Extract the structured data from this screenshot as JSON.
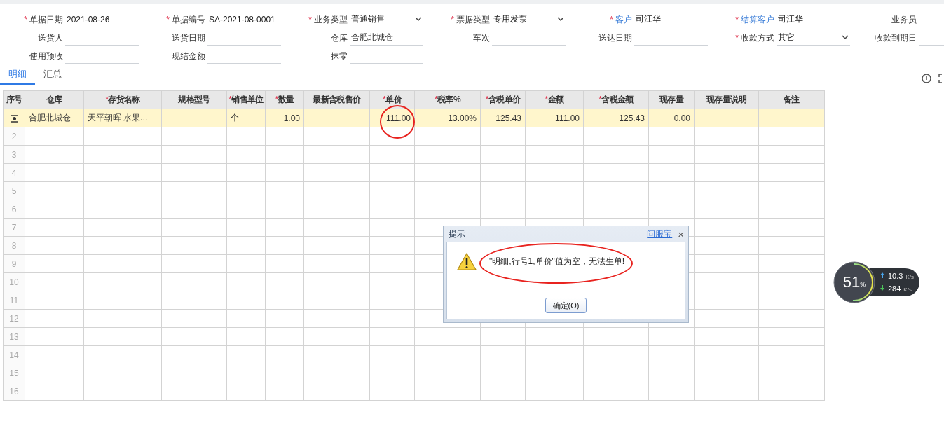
{
  "form": {
    "rows": [
      [
        {
          "mark": "*",
          "label": "单据日期",
          "value": "2021-08-26",
          "kind": "text",
          "link": false
        },
        {
          "mark": "*",
          "label": "单据编号",
          "value": "SA-2021-08-0001",
          "kind": "text",
          "link": false
        },
        {
          "mark": "*",
          "label": "业务类型",
          "value": "普通销售",
          "kind": "select",
          "link": false
        },
        {
          "mark": "*",
          "label": "票据类型",
          "value": "专用发票",
          "kind": "select",
          "link": false
        },
        {
          "mark": "*",
          "label": "客户",
          "value": "司江华",
          "kind": "text",
          "link": true
        },
        {
          "mark": "*",
          "label": "结算客户",
          "value": "司江华",
          "kind": "text",
          "link": true
        },
        {
          "label": "业务员",
          "kind": "text",
          "link": false
        }
      ],
      [
        {
          "label": "送货人",
          "kind": "text",
          "link": false
        },
        {
          "label": "送货日期",
          "kind": "text",
          "link": false
        },
        {
          "label": "仓库",
          "value": "合肥北城仓",
          "kind": "text",
          "link": false
        },
        {
          "label": "车次",
          "kind": "text",
          "link": false
        },
        {
          "label": "送达日期",
          "kind": "text",
          "link": false
        },
        {
          "mark": "*",
          "label": "收款方式",
          "value": "其它",
          "kind": "select",
          "link": false
        },
        {
          "label": "收款到期日",
          "kind": "text",
          "link": false
        }
      ],
      [
        {
          "label": "使用预收",
          "kind": "text",
          "link": false
        },
        {
          "label": "现结金额",
          "kind": "text",
          "link": false
        },
        {
          "label": "抹零",
          "kind": "text",
          "link": false
        }
      ]
    ]
  },
  "tabs": [
    {
      "label": "明细",
      "selected": true
    },
    {
      "label": "汇总",
      "selected": false
    }
  ],
  "table": {
    "columns": [
      {
        "label": "序号"
      },
      {
        "label": "仓库"
      },
      {
        "mark": "*",
        "label": "存货名称"
      },
      {
        "label": "规格型号"
      },
      {
        "mark": "*",
        "label": "销售单位"
      },
      {
        "mark": "*",
        "label": "数量"
      },
      {
        "label": "最新含税售价"
      },
      {
        "mark": "*",
        "label": "单价"
      },
      {
        "mark": "*",
        "label": "税率%"
      },
      {
        "mark": "*",
        "label": "含税单价"
      },
      {
        "mark": "*",
        "label": "金额"
      },
      {
        "mark": "*",
        "label": "含税金额"
      },
      {
        "label": "现存量"
      },
      {
        "label": "现存量说明"
      },
      {
        "label": "备注"
      }
    ],
    "rows": [
      {
        "selected": true,
        "cells": [
          {
            "text": "合肥北城仓",
            "circled": false
          },
          {
            "text": "天平朝晖 水果...",
            "circled": false
          },
          {
            "circled": false
          },
          {
            "text": "个",
            "circled": false
          },
          {
            "text": "1.00",
            "circled": false
          },
          {
            "circled": false
          },
          {
            "text": "111.00",
            "circled": true
          },
          {
            "text": "13.00%",
            "circled": false
          },
          {
            "text": "125.43",
            "circled": false
          },
          {
            "text": "111.00",
            "circled": false
          },
          {
            "text": "125.43",
            "circled": false
          },
          {
            "text": "0.00",
            "circled": false
          },
          {
            "circled": false
          },
          {
            "circled": false
          }
        ]
      },
      {
        "selected": false,
        "number": "2"
      },
      {
        "selected": false,
        "number": "3"
      },
      {
        "selected": false,
        "number": "4"
      },
      {
        "selected": false,
        "number": "5"
      },
      {
        "selected": false,
        "number": "6"
      },
      {
        "selected": false,
        "number": "7"
      },
      {
        "selected": false,
        "number": "8"
      },
      {
        "selected": false,
        "number": "9"
      },
      {
        "selected": false,
        "number": "10"
      },
      {
        "selected": false,
        "number": "11"
      },
      {
        "selected": false,
        "number": "12"
      },
      {
        "selected": false,
        "number": "13"
      },
      {
        "selected": false,
        "number": "14"
      },
      {
        "selected": false,
        "number": "15"
      },
      {
        "selected": false,
        "number": "16"
      }
    ]
  },
  "dialog": {
    "title": "提示",
    "help_link": "问服宝",
    "close": "×",
    "message": "\"明细,行号1,单价\"值为空，无法生单!",
    "message_circled": true,
    "button": "确定(O)"
  },
  "speed_widget": {
    "level": 0.51,
    "percent": "51",
    "percent_unit": "%",
    "upload": "10.3",
    "upload_unit": "K/s",
    "download": "284",
    "download_unit": "K/s"
  }
}
